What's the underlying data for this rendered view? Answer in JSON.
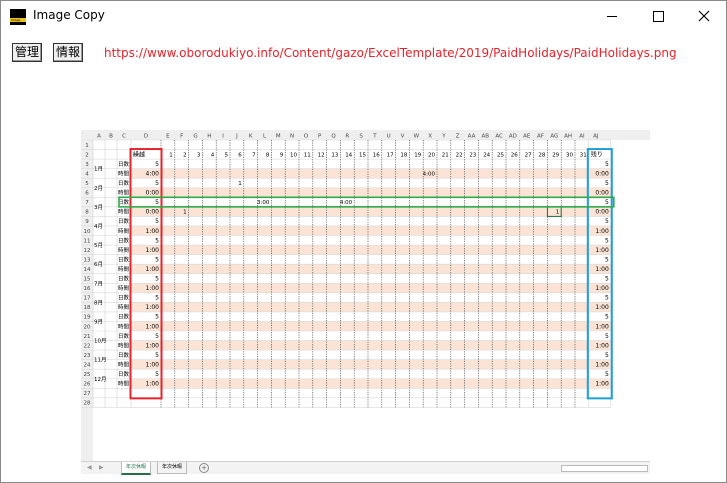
{
  "window": {
    "title": "Image Copy",
    "icon": "image-app-icon",
    "icon_text": "Image",
    "controls": {
      "minimize": "minimize-icon",
      "maximize": "maximize-icon",
      "close": "close-icon"
    }
  },
  "toolbar": {
    "manage_label": "管理",
    "info_label": "情報",
    "url": "https://www.oborodukiyo.info/Content/gazo/ExcelTemplate/2019/PaidHolidays/PaidHolidays.png"
  },
  "spreadsheet": {
    "col_letters": [
      "A",
      "B",
      "C",
      "D",
      "E",
      "F",
      "G",
      "H",
      "I",
      "J",
      "K",
      "L",
      "M",
      "N",
      "O",
      "P",
      "Q",
      "R",
      "S",
      "T",
      "U",
      "V",
      "W",
      "X",
      "Y",
      "Z",
      "AA",
      "AB",
      "AC",
      "AD",
      "AE",
      "AF",
      "AG",
      "AH",
      "AI",
      "AJ"
    ],
    "row_numbers": [
      "1",
      "2",
      "3",
      "4",
      "5",
      "6",
      "7",
      "8",
      "9",
      "10",
      "11",
      "12",
      "13",
      "14",
      "15",
      "16",
      "17",
      "18",
      "19",
      "20",
      "21",
      "22",
      "23",
      "24",
      "25",
      "26",
      "27",
      "28"
    ],
    "day_numbers": [
      "1",
      "2",
      "3",
      "4",
      "5",
      "6",
      "7",
      "8",
      "9",
      "10",
      "11",
      "12",
      "13",
      "14",
      "15",
      "16",
      "17",
      "18",
      "19",
      "20",
      "21",
      "22",
      "23",
      "24",
      "25",
      "26",
      "27",
      "28",
      "29",
      "30",
      "31"
    ],
    "carry_header": "繰越",
    "remain_header": "残り",
    "months": [
      "1月",
      "2月",
      "3月",
      "4月",
      "5月",
      "6月",
      "7月",
      "8月",
      "9月",
      "10月",
      "11月",
      "12月"
    ],
    "row_kinds": [
      "日数",
      "時間"
    ],
    "carry_values": [
      "5",
      "4:00",
      "5",
      "0:00",
      "5",
      "0:00",
      "5",
      "1:00",
      "5",
      "1:00",
      "5",
      "1:00",
      "5",
      "1:00",
      "5",
      "1:00",
      "5",
      "1:00",
      "5",
      "1:00",
      "5",
      "1:00",
      "5",
      "1:00"
    ],
    "remain_values": [
      "5",
      "0:00",
      "5",
      "0:00",
      "5",
      "0:00",
      "5",
      "1:00",
      "5",
      "1:00",
      "5",
      "1:00",
      "5",
      "1:00",
      "5",
      "1:00",
      "5",
      "1:00",
      "5",
      "1:00",
      "5",
      "1:00",
      "5",
      "1:00"
    ],
    "cell_notes": [
      {
        "row": 3,
        "col": 20,
        "text": "4:00"
      },
      {
        "row": 4,
        "col": 6,
        "text": "1"
      },
      {
        "row": 6,
        "col": 8,
        "text": "3:00"
      },
      {
        "row": 6,
        "col": 14,
        "text": "4:00"
      },
      {
        "row": 7,
        "col": 2,
        "text": "1"
      },
      {
        "row": 7,
        "col": 29,
        "text": "1"
      }
    ],
    "tabs": [
      "年次休暇",
      "年次休暇"
    ],
    "highlight_colors": {
      "carry_box": "#e8232b",
      "remain_box": "#1ea0dc",
      "row_box": "#2eaa4a",
      "stripe": "#fbe4d6"
    }
  }
}
